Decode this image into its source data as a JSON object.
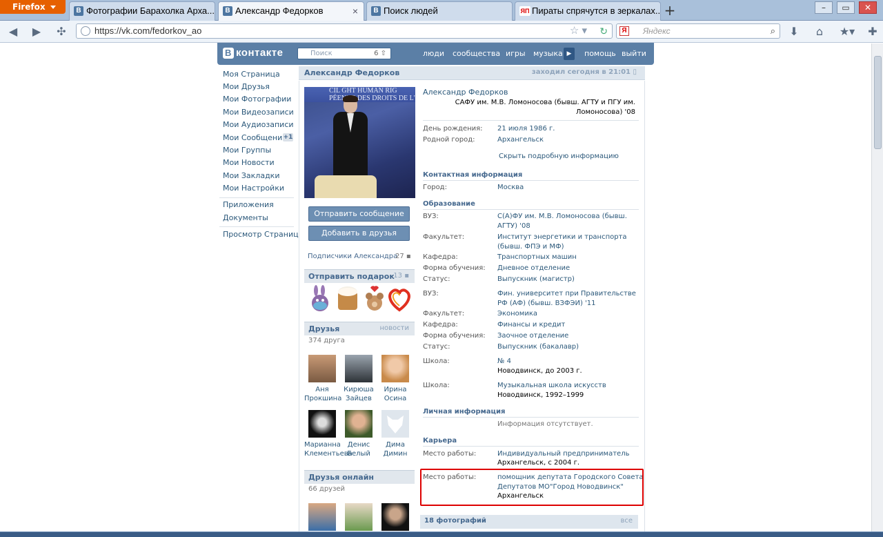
{
  "browser": {
    "app_button": "Firefox",
    "tabs": [
      {
        "label": "Фотографии Барахолка Арха...",
        "favicon": "В"
      },
      {
        "label": "Александр Федорков",
        "favicon": "В"
      },
      {
        "label": "Поиск людей",
        "favicon": "В"
      },
      {
        "label": "Пираты спрячутся в зеркалах...",
        "favicon": "ЯП"
      }
    ],
    "url": "https://vk.com/fedorkov_ao",
    "search_placeholder": "Яндекс",
    "search_engine_icon": "Я"
  },
  "vk": {
    "logo": "контакте",
    "logo_b": "В",
    "search_placeholder": "Поиск",
    "search_count": "6",
    "nav": [
      "люди",
      "сообщества",
      "игры",
      "музыка",
      "помощь",
      "выйти"
    ]
  },
  "left_menu": {
    "items": [
      "Моя Страница",
      "Мои Друзья",
      "Мои Фотографии",
      "Мои Видеозаписи",
      "Мои Аудиозаписи",
      "Мои Сообщения",
      "Мои Группы",
      "Мои Новости",
      "Мои Закладки",
      "Мои Настройки"
    ],
    "messages_badge": "+1",
    "extra": [
      "Приложения",
      "Документы"
    ],
    "view_pages": "Просмотр Страниц"
  },
  "profile": {
    "header_name": "Александр Федорков",
    "last_seen": "заходил сегодня в 21:01",
    "photo_banner_1": "CIL GHT HUMAN RIG",
    "photo_banner_2": "PÉENNE DES DROITS DE L'H",
    "send_message": "Отправить сообщение",
    "add_friend": "Добавить в друзья",
    "followers": "Подписчики Александра",
    "followers_count": "27",
    "gifts_title": "Отправить подарок",
    "gifts_count": "13",
    "friends_title": "Друзья",
    "friends_news": "новости",
    "friends_count": "374 друга",
    "friends": [
      {
        "first": "Аня",
        "last": "Прокшина"
      },
      {
        "first": "Кирюша",
        "last": "Зайцев"
      },
      {
        "first": "Ирина",
        "last": "Осина"
      },
      {
        "first": "Марианна",
        "last": "Клементьева"
      },
      {
        "first": "Денис",
        "last": "Белый"
      },
      {
        "first": "Дима",
        "last": "Димин"
      }
    ],
    "online_title": "Друзья онлайн",
    "online_count": "66 друзей"
  },
  "info": {
    "name": "Александр Федорков",
    "university_line": "САФУ им. М.В. Ломоносова (бывш. АГТУ и ПГУ им.",
    "university_line2": "Ломоносова) '08",
    "birthday_label": "День рождения:",
    "birthday": "21 июля 1986 г.",
    "hometown_label": "Родной город:",
    "hometown": "Архангельск",
    "hide_details": "Скрыть подробную информацию",
    "contact_title": "Контактная информация",
    "city_label": "Город:",
    "city": "Москва",
    "education_title": "Образование",
    "uni1_label": "ВУЗ:",
    "uni1_a": "С(А)ФУ им. М.В. Ломоносова (бывш.",
    "uni1_b": "АГТУ) '08",
    "fac1_label": "Факультет:",
    "fac1_a": "Институт энергетики и транспорта",
    "fac1_b": "(бывш. ФПЭ и МФ)",
    "dep1_label": "Кафедра:",
    "dep1": "Транспортных машин",
    "form1_label": "Форма обучения:",
    "form1": "Дневное отделение",
    "status1_label": "Статус:",
    "status1": "Выпускник (магистр)",
    "uni2_label": "ВУЗ:",
    "uni2_a": "Фин. университет при Правительстве",
    "uni2_b": "РФ (АФ) (бывш. ВЗФЭИ) '11",
    "fac2_label": "Факультет:",
    "fac2": "Экономика",
    "dep2_label": "Кафедра:",
    "dep2": "Финансы и кредит",
    "form2_label": "Форма обучения:",
    "form2": "Заочное отделение",
    "status2_label": "Статус:",
    "status2": "Выпускник (бакалавр)",
    "school1_label": "Школа:",
    "school1": "№ 4",
    "school1_loc": "Новодвинск, до 2003 г.",
    "school2_label": "Школа:",
    "school2": "Музыкальная школа искусств",
    "school2_loc": "Новодвинск, 1992–1999",
    "personal_title": "Личная информация",
    "personal_empty": "Информация отсутствует.",
    "career_title": "Карьера",
    "job1_label": "Место работы:",
    "job1": "Индивидуальный предприниматель",
    "job1_loc": "Архангельск, с 2004 г.",
    "job2_label": "Место работы:",
    "job2_a": "помощник депутата Городского Совета",
    "job2_b": "Депутатов МО\"Город Новодвинск\"",
    "job2_loc": "Архангельск",
    "photos_title": "18 фотографий",
    "photos_all": "все"
  },
  "colors": {
    "vk_blue": "#5b7fa6",
    "link": "#2b587a",
    "highlight": "#dd0000"
  }
}
